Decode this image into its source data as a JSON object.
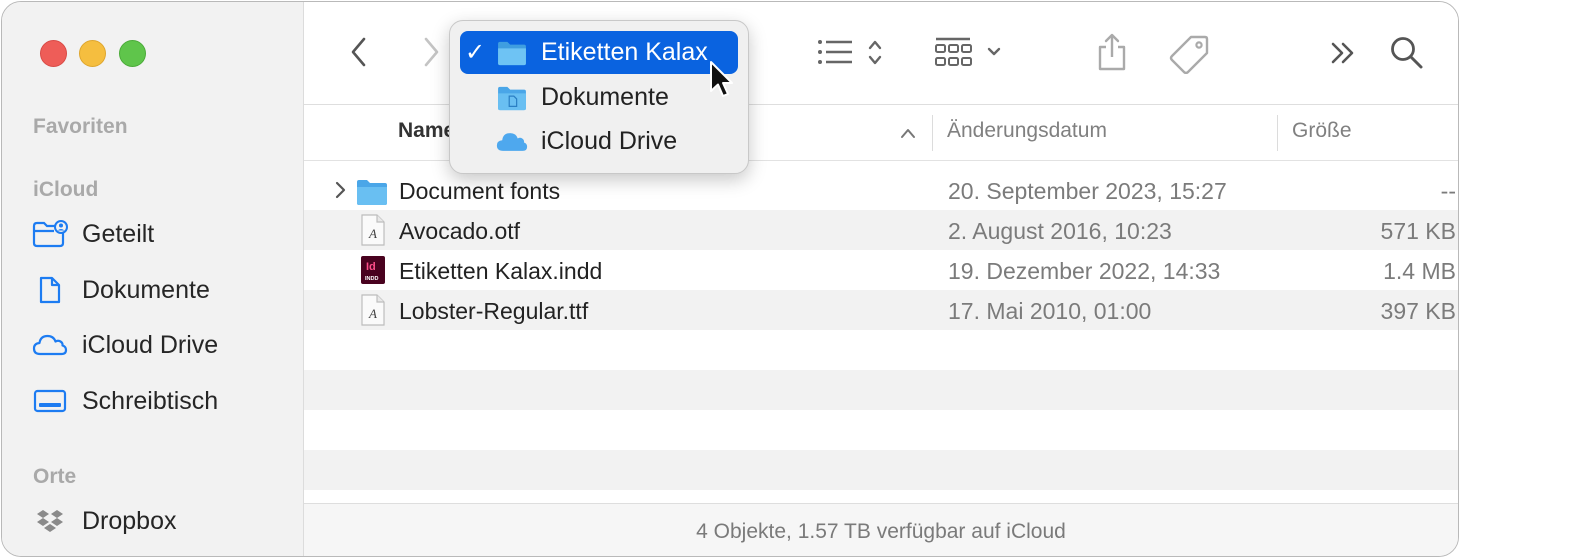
{
  "sidebar": {
    "sections": {
      "favorites": "Favoriten",
      "icloud": "iCloud",
      "places": "Orte"
    },
    "items": [
      {
        "label": "Geteilt",
        "icon": "shared-folder-icon"
      },
      {
        "label": "Dokumente",
        "icon": "document-icon"
      },
      {
        "label": "iCloud Drive",
        "icon": "cloud-icon"
      },
      {
        "label": "Schreibtisch",
        "icon": "desktop-icon"
      },
      {
        "label": "Dropbox",
        "icon": "dropbox-icon"
      }
    ]
  },
  "popup": {
    "items": [
      {
        "label": "Etiketten Kalax",
        "checked": true,
        "icon": "folder-icon"
      },
      {
        "label": "Dokumente",
        "checked": false,
        "icon": "documents-folder-icon"
      },
      {
        "label": "iCloud Drive",
        "checked": false,
        "icon": "cloud-icon"
      }
    ],
    "check_glyph": "✓"
  },
  "columns": {
    "name": "Name",
    "date": "Änderungsdatum",
    "size": "Größe"
  },
  "files": [
    {
      "name": "Document fonts",
      "date": "20. September 2023, 15:27",
      "size": "--",
      "icon": "folder-icon"
    },
    {
      "name": "Avocado.otf",
      "date": "2. August 2016, 10:23",
      "size": "571 KB",
      "icon": "font-file-icon"
    },
    {
      "name": "Etiketten Kalax.indd",
      "date": "19. Dezember 2022, 14:33",
      "size": "1.4 MB",
      "icon": "indesign-file-icon"
    },
    {
      "name": "Lobster-Regular.ttf",
      "date": "17. Mai 2010, 01:00",
      "size": "397 KB",
      "icon": "font-file-icon"
    }
  ],
  "indesign_badge": {
    "top": "Id",
    "bottom": "INDD"
  },
  "font_badge": "A",
  "status": "4 Objekte, 1.57 TB verfügbar auf iCloud",
  "colors": {
    "accent": "#0a63e0",
    "folder": "#5fb4ec",
    "traffic_red": "#ee5d58",
    "traffic_yellow": "#f5be3f",
    "traffic_green": "#5fc54b"
  }
}
